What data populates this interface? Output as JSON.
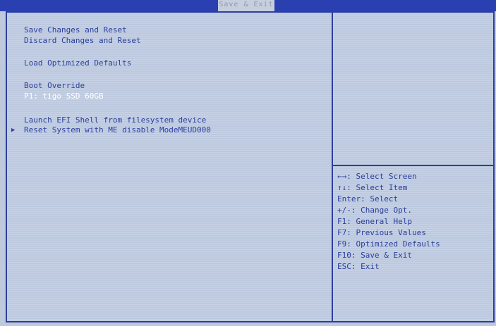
{
  "header": {
    "active_tab": "Save & Exit"
  },
  "menu": {
    "save_changes_reset": "Save Changes and Reset",
    "discard_changes_reset": "Discard Changes and Reset",
    "load_optimized_defaults": "Load Optimized Defaults",
    "boot_override_label": "Boot Override",
    "boot_device": "P1: tigo SSD 60GB",
    "launch_efi_shell": "Launch EFI Shell from filesystem device",
    "reset_me_disable": "Reset System with ME disable ModeMEUD000"
  },
  "help": {
    "select_screen": "←→: Select Screen",
    "select_item": "↑↓: Select Item",
    "enter_select": "Enter: Select",
    "change_opt": "+/-: Change Opt.",
    "general_help": "F1: General Help",
    "previous_values": "F7: Previous Values",
    "optimized_defaults": "F9: Optimized Defaults",
    "save_exit": "F10: Save & Exit",
    "esc_exit": "ESC: Exit"
  },
  "icons": {
    "selection_pointer": "triangle-right"
  },
  "colors": {
    "background": "#c1cde3",
    "text": "#2b3f9c",
    "border": "#2c3f9e",
    "highlight_text": "#ffffff"
  }
}
